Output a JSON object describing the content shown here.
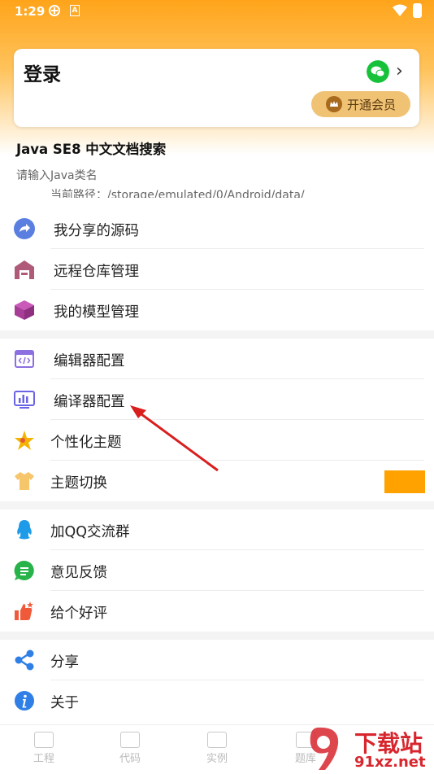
{
  "status": {
    "time": "1:29",
    "small_icon_letter": "A"
  },
  "login": {
    "title": "登录",
    "vip_label": "开通会员"
  },
  "doc_search": {
    "title": "Java SE8 中文文档搜索",
    "placeholder": "请输入Java类名"
  },
  "path_line": "当前路径：/storage/emulated/0/Android/data/",
  "menu": {
    "shared_source": "我分享的源码",
    "remote_repo": "远程仓库管理",
    "my_models": "我的模型管理",
    "editor_config": "编辑器配置",
    "compiler_config": "编译器配置",
    "personal_theme": "个性化主题",
    "theme_switch": "主题切换",
    "join_qq": "加QQ交流群",
    "feedback": "意见反馈",
    "rate": "给个好评",
    "share": "分享",
    "about": "关于"
  },
  "bottom_nav": [
    "工程",
    "代码",
    "实例",
    "题库"
  ],
  "watermark": {
    "line1": "下载站",
    "line2": "91xz.net"
  },
  "colors": {
    "accent": "#ffa200",
    "wechat": "#17c23a",
    "vip_bg": "#f0c274",
    "arrow": "#d91e1e"
  }
}
